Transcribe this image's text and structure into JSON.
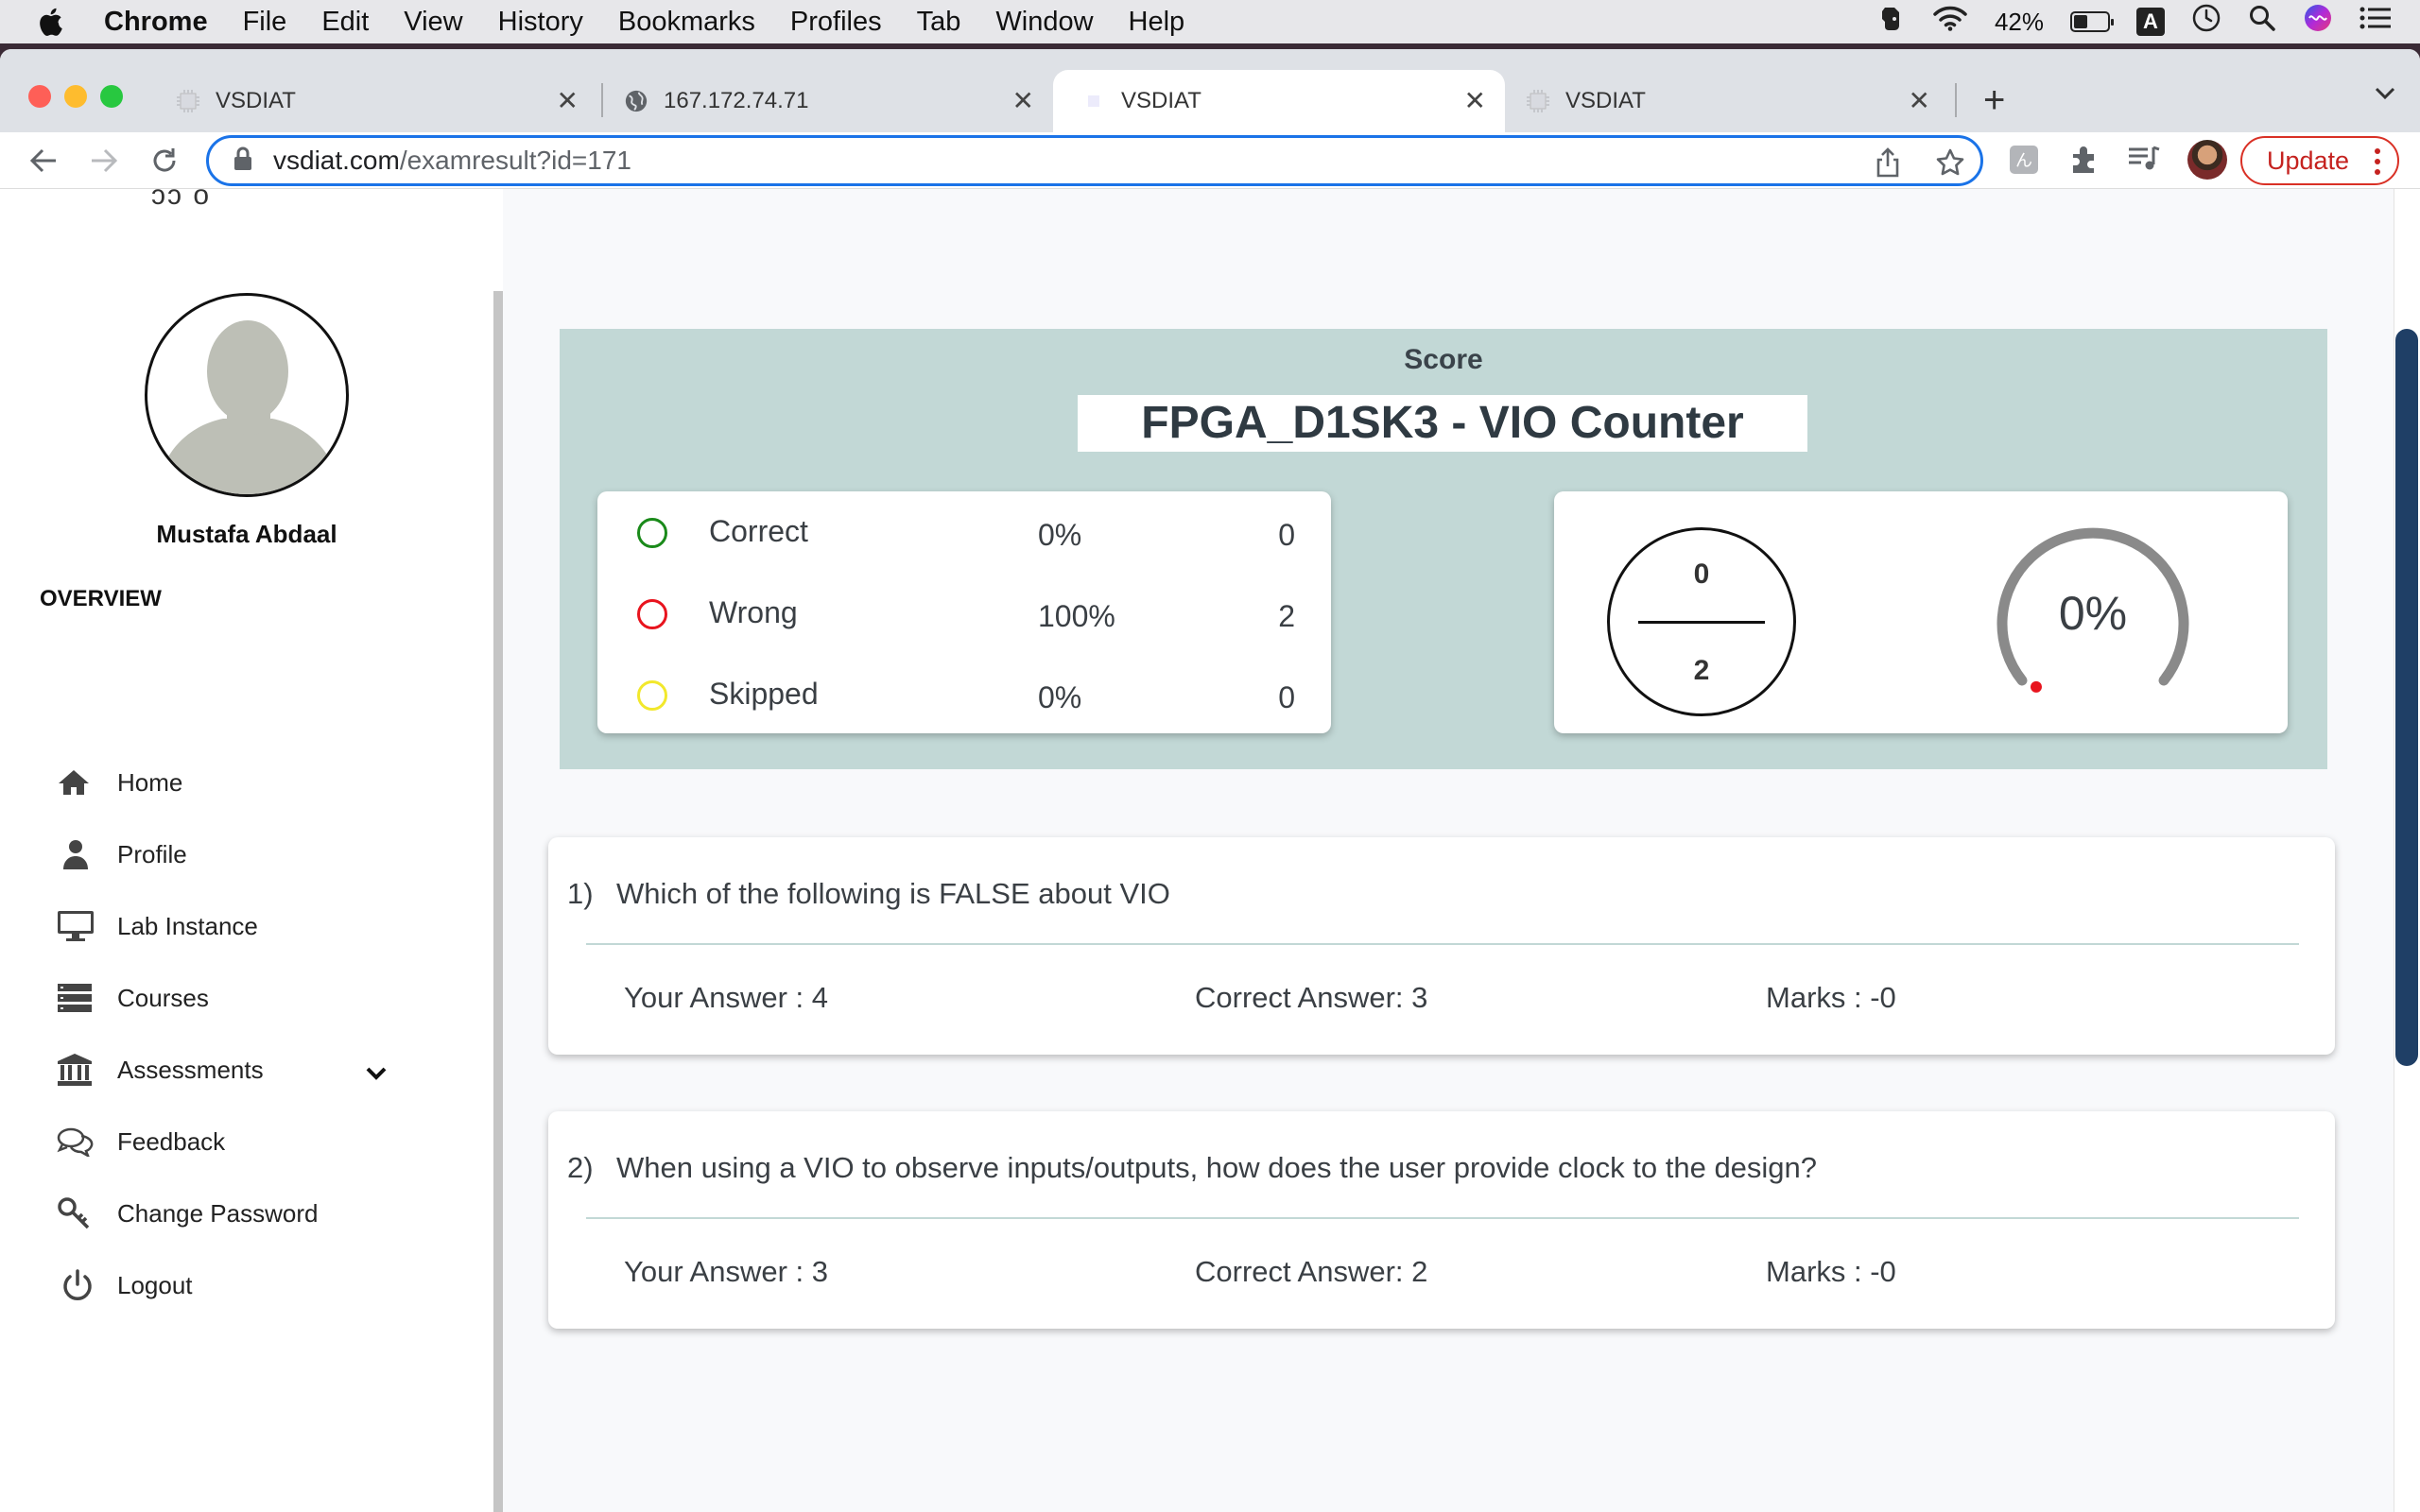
{
  "menubar": {
    "app": "Chrome",
    "items": [
      "File",
      "Edit",
      "View",
      "History",
      "Bookmarks",
      "Profiles",
      "Tab",
      "Window",
      "Help"
    ],
    "battery": "42%",
    "battery_level": 0.42,
    "input_source": "A"
  },
  "tabs": [
    {
      "title": "VSDIAT",
      "icon": "chip-icon",
      "active": false
    },
    {
      "title": "167.172.74.71",
      "icon": "globe-icon",
      "active": false
    },
    {
      "title": "VSDIAT",
      "icon": "chip-icon",
      "active": true
    },
    {
      "title": "VSDIAT",
      "icon": "chip-icon",
      "active": false
    }
  ],
  "toolbar": {
    "url_host": "vsdiat.com",
    "url_path": "/examresult?id=171",
    "update_label": "Update"
  },
  "sidebar": {
    "logo_fragment": "ɔɔ ȏ",
    "user_name": "Mustafa Abdaal",
    "section_label": "OVERVIEW",
    "items": [
      {
        "label": "Home",
        "icon": "home-icon"
      },
      {
        "label": "Profile",
        "icon": "user-icon"
      },
      {
        "label": "Lab Instance",
        "icon": "monitor-icon"
      },
      {
        "label": "Courses",
        "icon": "list-icon"
      },
      {
        "label": "Assessments",
        "icon": "institution-icon"
      },
      {
        "label": "Feedback",
        "icon": "chat-icon"
      },
      {
        "label": "Change Password",
        "icon": "key-icon"
      },
      {
        "label": "Logout",
        "icon": "power-icon"
      }
    ]
  },
  "score": {
    "heading": "Score",
    "exam_title": "FPGA_D1SK3 - VIO Counter",
    "stats": [
      {
        "label": "Correct",
        "percent": "0%",
        "count": "0",
        "color": "#1a8a1a"
      },
      {
        "label": "Wrong",
        "percent": "100%",
        "count": "2",
        "color": "#e8141e"
      },
      {
        "label": "Skipped",
        "percent": "0%",
        "count": "0",
        "color": "#f2e82c"
      }
    ],
    "fraction": {
      "numerator": "0",
      "denominator": "2"
    },
    "gauge": {
      "text": "0%",
      "value": 0
    }
  },
  "questions": [
    {
      "number": "1)",
      "text": "Which of the following is FALSE about VIO",
      "your_answer": "Your Answer : 4",
      "correct_answer": "Correct Answer: 3",
      "marks": "Marks : -0"
    },
    {
      "number": "2)",
      "text": "When using a VIO to observe inputs/outputs, how does the user provide clock to the design?",
      "your_answer": "Your Answer : 3",
      "correct_answer": "Correct Answer: 2",
      "marks": "Marks : -0"
    }
  ],
  "colors": {
    "score_panel": "#c2d8d6",
    "update_red": "#d93025",
    "omnibox_focus": "#1a73e8",
    "scroll_thumb": "#1f3f66"
  }
}
